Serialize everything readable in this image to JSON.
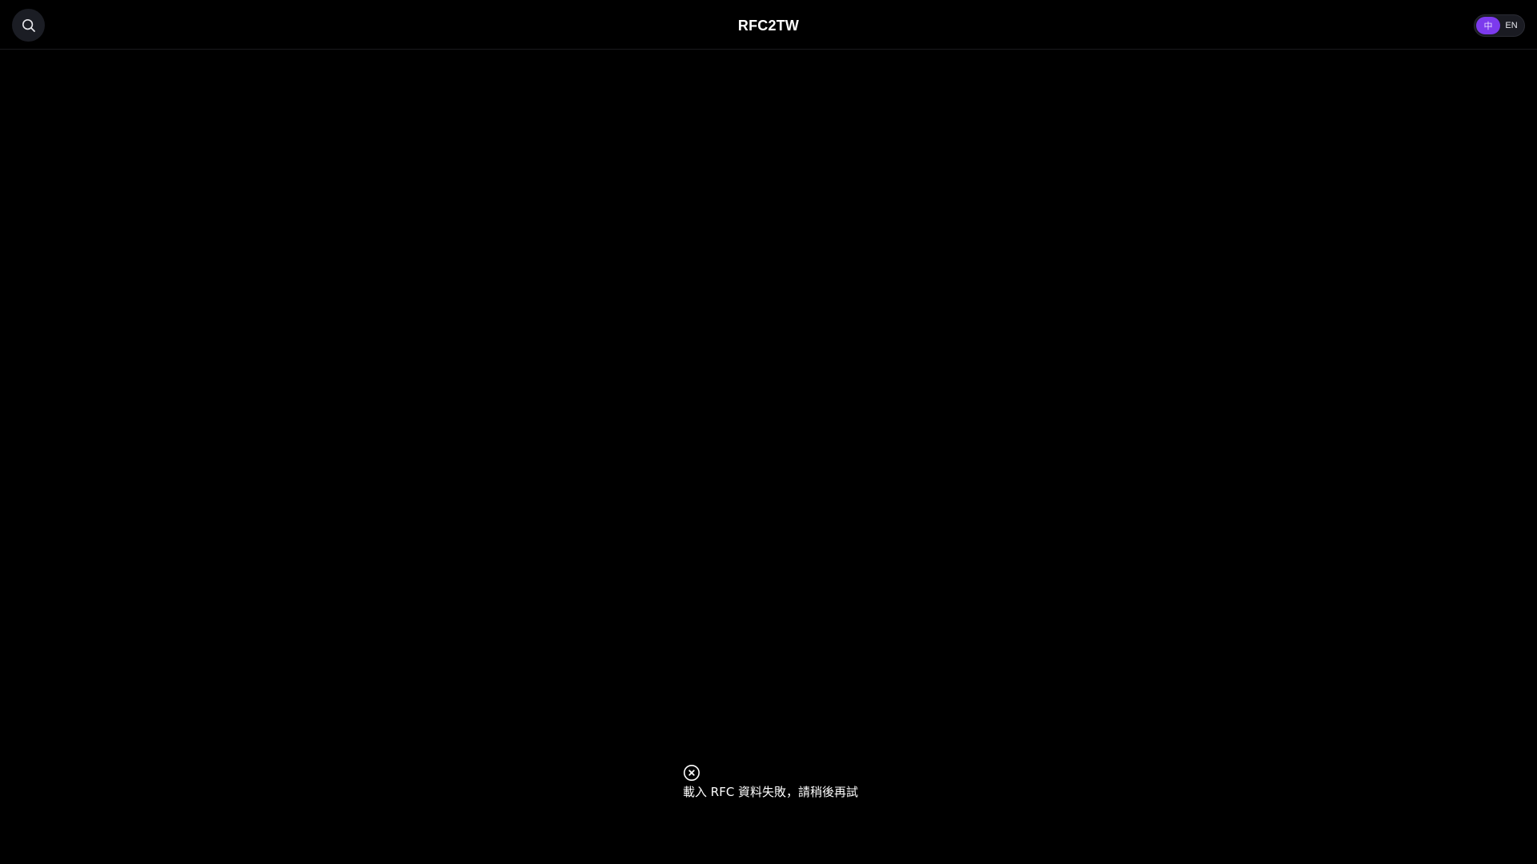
{
  "header": {
    "title": "RFC2TW",
    "search_icon": "search-icon",
    "language_toggle": {
      "options": [
        {
          "label": "中",
          "selected": true
        },
        {
          "label": "EN",
          "selected": false
        }
      ],
      "active_color": "#7c3aed"
    }
  },
  "main": {
    "error": {
      "icon": "close-circle-icon",
      "message": "載入 RFC 資料失敗，請稍後再試"
    }
  },
  "theme": {
    "background": "#000000",
    "text": "#ffffff"
  }
}
